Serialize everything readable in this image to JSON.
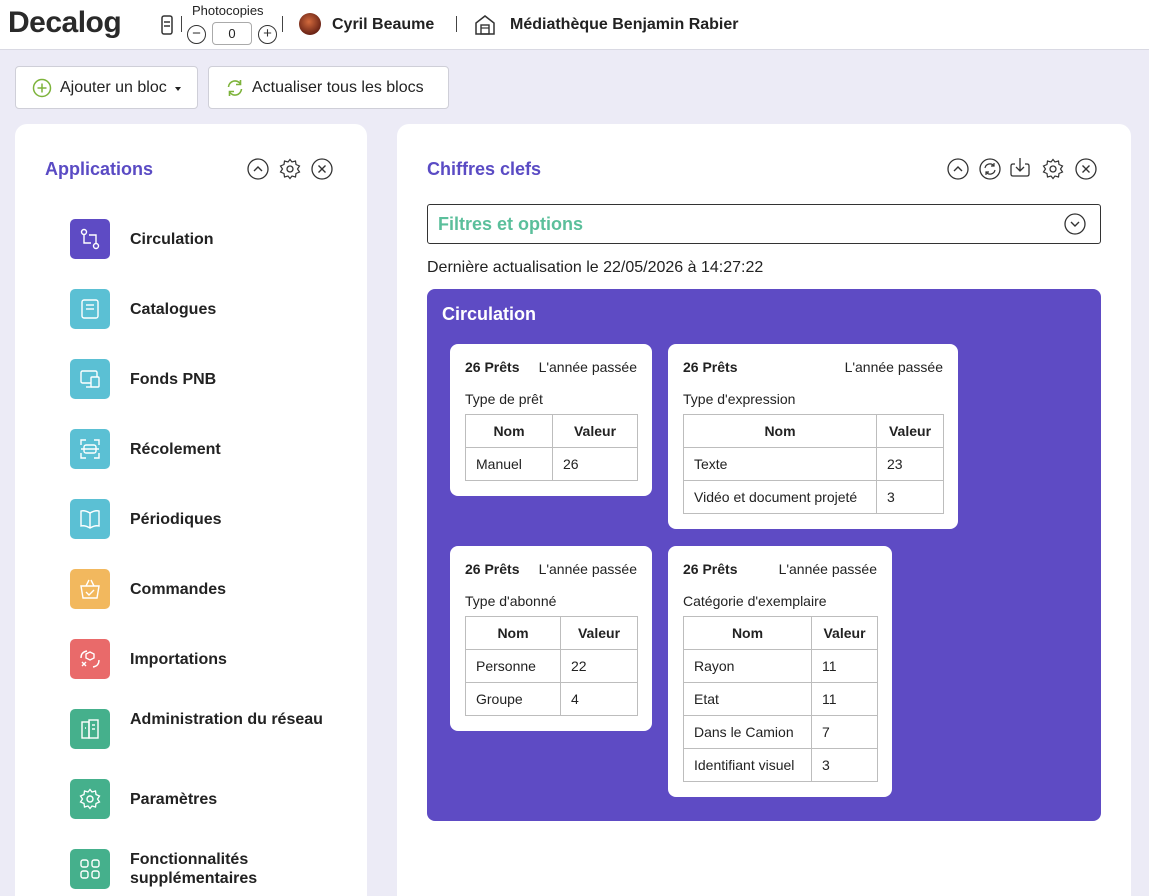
{
  "header": {
    "logo": "Decalog",
    "photocopies_label": "Photocopies",
    "photocopies_value": "0",
    "minus": "−",
    "plus": "+",
    "user_name": "Cyril Beaume",
    "library_name": "Médiathèque Benjamin Rabier"
  },
  "toolbar": {
    "add_block": "Ajouter un bloc",
    "refresh_all": "Actualiser tous les blocs"
  },
  "applications": {
    "title": "Applications",
    "items": [
      {
        "label": "Circulation",
        "icon": "swap-icon",
        "color": "#5e4bc4"
      },
      {
        "label": "Catalogues",
        "icon": "book-icon",
        "color": "#5bc0d4"
      },
      {
        "label": "Fonds PNB",
        "icon": "monitor-icon",
        "color": "#5bc0d4"
      },
      {
        "label": "Récolement",
        "icon": "scan-icon",
        "color": "#5bc0d4"
      },
      {
        "label": "Périodiques",
        "icon": "open-book-icon",
        "color": "#5bc0d4"
      },
      {
        "label": "Commandes",
        "icon": "basket-icon",
        "color": "#f2b85e"
      },
      {
        "label": "Importations",
        "icon": "import-icon",
        "color": "#e96a6a"
      },
      {
        "label": "Administration du réseau",
        "icon": "building-icon",
        "color": "#45b08c"
      },
      {
        "label": "Paramètres",
        "icon": "gear-icon",
        "color": "#45b08c"
      },
      {
        "label": "Fonctionnalités supplémentaires",
        "icon": "grid-icon",
        "color": "#45b08c"
      }
    ]
  },
  "chiffres": {
    "title": "Chiffres clefs",
    "filters_label": "Filtres et options",
    "updated": "Dernière actualisation le 22/05/2026 à 14:27:22",
    "section_title": "Circulation",
    "cards": [
      {
        "count": "26 Prêts",
        "period": "L'année passée",
        "subtitle": "Type de prêt",
        "col_name": "Nom",
        "col_value": "Valeur",
        "rows": [
          {
            "name": "Manuel",
            "value": "26"
          }
        ]
      },
      {
        "count": "26 Prêts",
        "period": "L'année passée",
        "subtitle": "Type d'expression",
        "col_name": "Nom",
        "col_value": "Valeur",
        "rows": [
          {
            "name": "Texte",
            "value": "23"
          },
          {
            "name": "Vidéo et document projeté",
            "value": "3"
          }
        ]
      },
      {
        "count": "26 Prêts",
        "period": "L'année passée",
        "subtitle": "Type d'abonné",
        "col_name": "Nom",
        "col_value": "Valeur",
        "rows": [
          {
            "name": "Personne",
            "value": "22"
          },
          {
            "name": "Groupe",
            "value": "4"
          }
        ]
      },
      {
        "count": "26 Prêts",
        "period": "L'année passée",
        "subtitle": "Catégorie d'exemplaire",
        "col_name": "Nom",
        "col_value": "Valeur",
        "rows": [
          {
            "name": "Rayon",
            "value": "11"
          },
          {
            "name": "Etat",
            "value": "11"
          },
          {
            "name": "Dans le Camion",
            "value": "7"
          },
          {
            "name": "Identifiant visuel",
            "value": "3"
          }
        ]
      }
    ]
  }
}
